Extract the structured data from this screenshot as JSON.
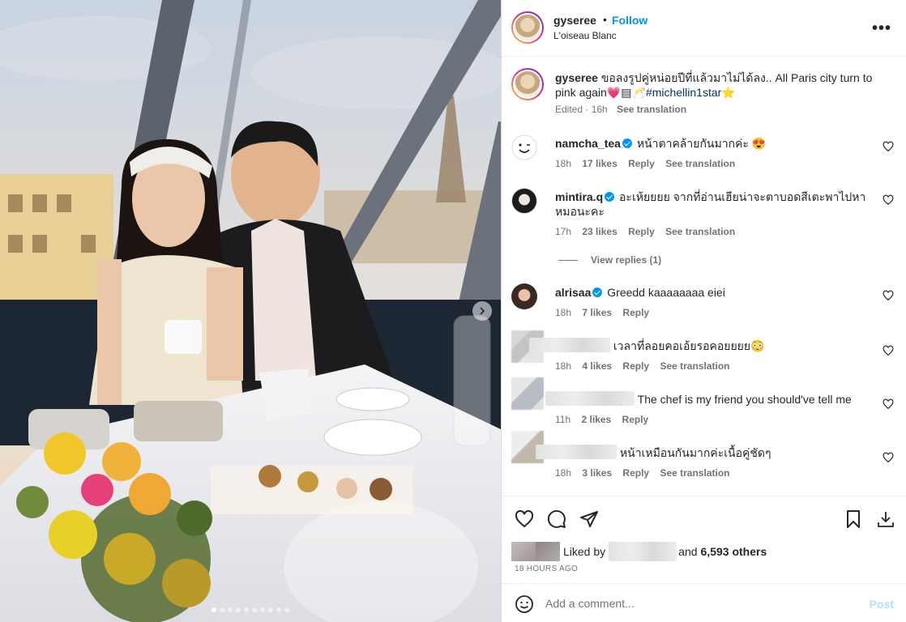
{
  "post": {
    "username": "gyseree",
    "follow_label": "Follow",
    "separator": "•",
    "location": "L'oiseau Blanc",
    "more_label": "•••",
    "carousel": {
      "total": 10,
      "active": 0
    }
  },
  "caption": {
    "username": "gyseree",
    "text": "ขอลงรูปคู่หน่อยปีที่แล้วมาไม่ได้ลง.. All Paris city turn to pink again💗▤🥂",
    "hashtag": "#michellin1star",
    "trailing": "⭐",
    "edited": "Edited · 16h",
    "see_translation": "See translation"
  },
  "comments": [
    {
      "username": "namcha_tea",
      "verified": true,
      "text": "หน้าตาคล้ายกันมากค่ะ 😍",
      "time": "18h",
      "likes": "17 likes",
      "reply": "Reply",
      "translation": "See translation"
    },
    {
      "username": "mintira.q",
      "verified": true,
      "text": "อะเห้ยยยย จากที่อ่านเฮียน่าจะตาบอดสีเตะพาไปหาหมอนะคะ",
      "time": "17h",
      "likes": "23 likes",
      "reply": "Reply",
      "translation": "See translation"
    },
    {
      "username": "alrisaa",
      "verified": true,
      "text": "Greedd kaaaaaaaa eiei",
      "time": "18h",
      "likes": "7 likes",
      "reply": "Reply",
      "translation": ""
    },
    {
      "username": "",
      "verified": false,
      "text": "เวลาที่ลอยคอเอ้ยรอคอยยยย😳",
      "time": "18h",
      "likes": "4 likes",
      "reply": "Reply",
      "translation": "See translation"
    },
    {
      "username": "",
      "verified": false,
      "text": "The chef is my friend you should've tell me",
      "time": "11h",
      "likes": "2 likes",
      "reply": "Reply",
      "translation": ""
    },
    {
      "username": "",
      "verified": false,
      "text": "หน้าเหมือนกันมากค่ะเนื้อคู่ชัดๆ",
      "time": "18h",
      "likes": "3 likes",
      "reply": "Reply",
      "translation": "See translation"
    }
  ],
  "view_replies": "View replies (1)",
  "likes": {
    "prefix": "Liked by",
    "and": "and",
    "others": "6,593 others",
    "time_ago": "18 HOURS AGO"
  },
  "add_comment": {
    "placeholder": "Add a comment...",
    "post_label": "Post"
  },
  "colors": {
    "accent": "#0095f6",
    "hashtag": "#00376b",
    "muted": "#737373",
    "post_disabled": "#b2dffc"
  }
}
